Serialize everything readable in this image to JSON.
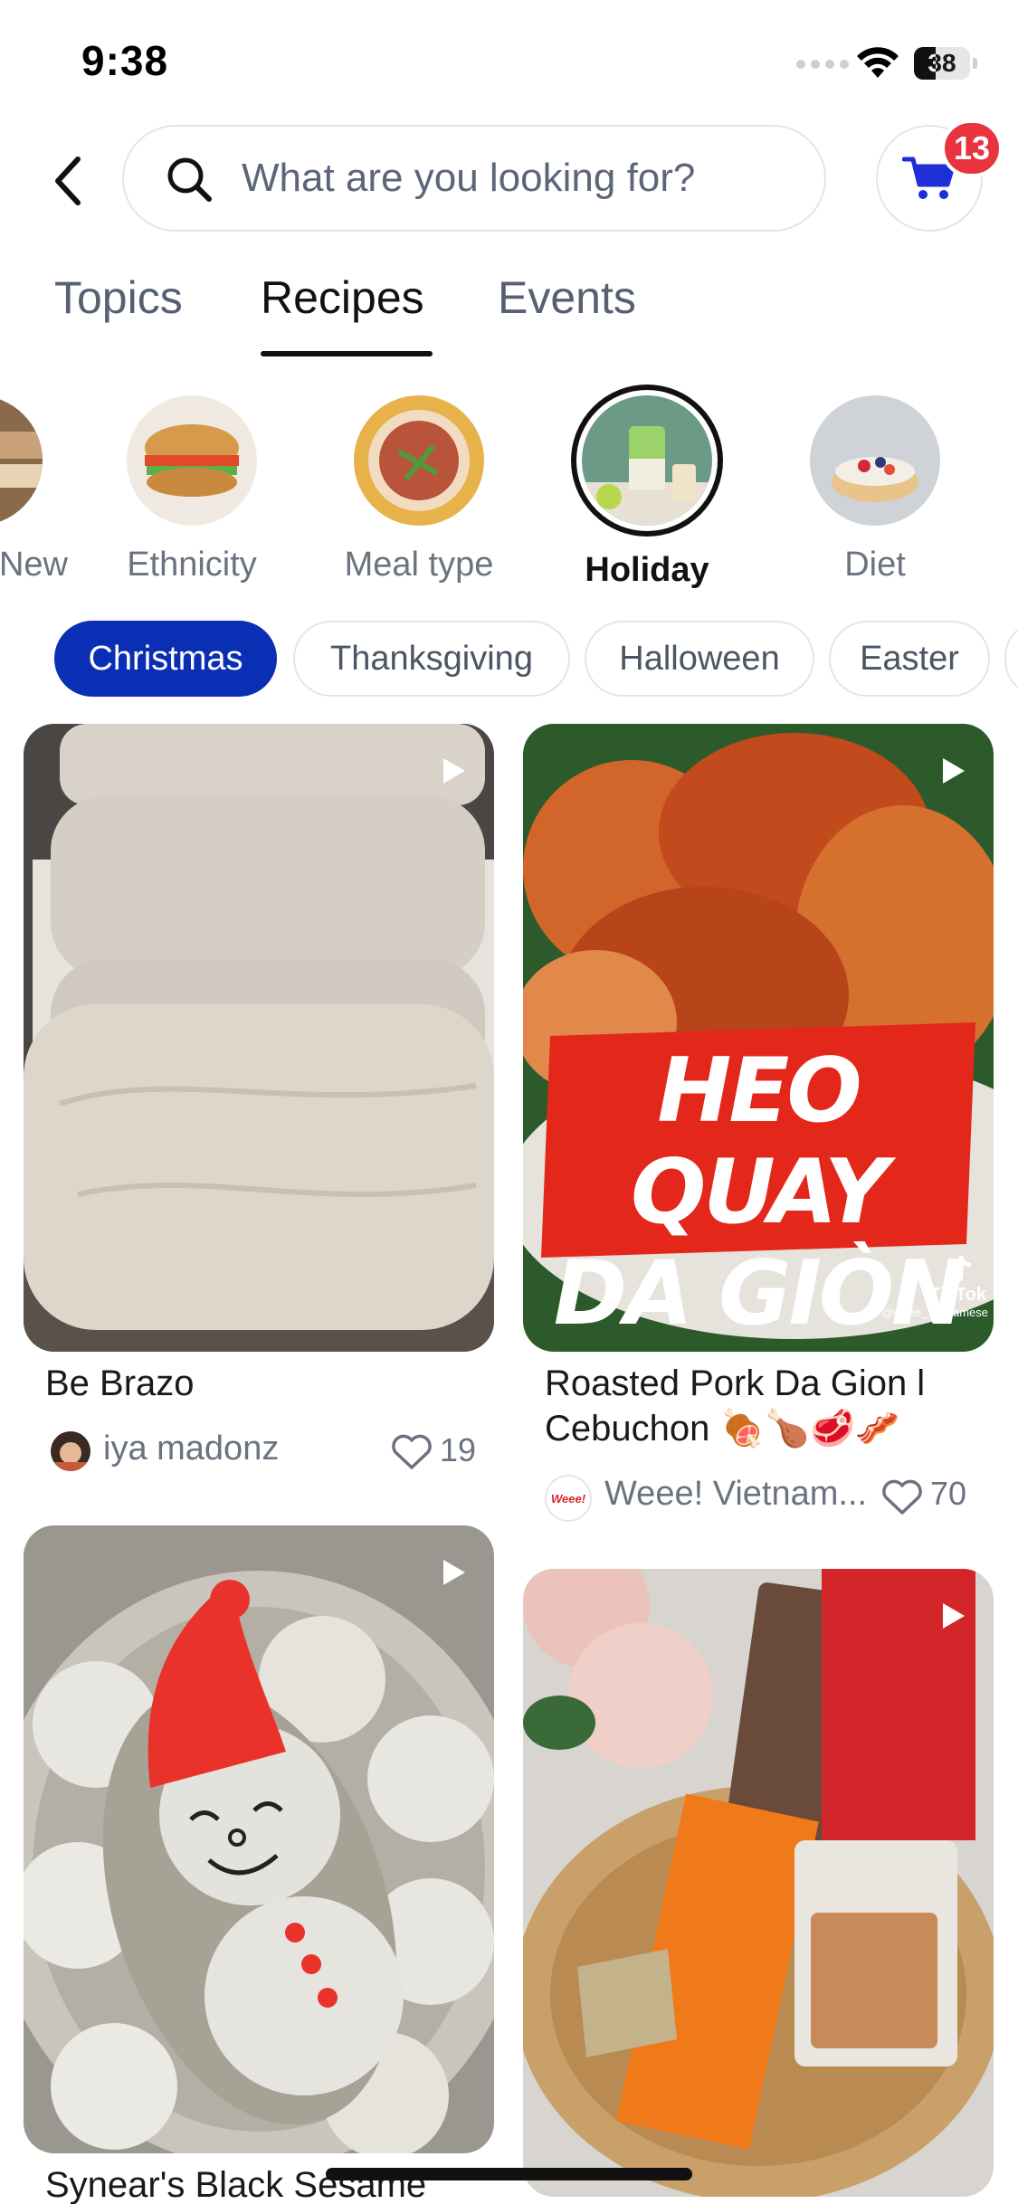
{
  "status_bar": {
    "time": "9:38",
    "battery": "38",
    "battery_level": 0.38
  },
  "search": {
    "placeholder": "What are you looking for?"
  },
  "cart": {
    "badge_count": "13"
  },
  "tabs": [
    {
      "label": "Topics"
    },
    {
      "label": "Recipes",
      "active": true
    },
    {
      "label": "Events"
    }
  ],
  "categories": [
    {
      "label": "New",
      "icon": "new-dish-image"
    },
    {
      "label": "Ethnicity",
      "icon": "sandwich-image"
    },
    {
      "label": "Meal type",
      "icon": "stew-bowl-image"
    },
    {
      "label": "Holiday",
      "icon": "green-drink-image",
      "active": true
    },
    {
      "label": "Diet",
      "icon": "fruit-tart-image"
    }
  ],
  "chips": [
    {
      "label": "Christmas",
      "active": true
    },
    {
      "label": "Thanksgiving"
    },
    {
      "label": "Halloween"
    },
    {
      "label": "Easter"
    }
  ],
  "recipes": [
    {
      "title": "Be Brazo",
      "author": "iya madonz",
      "likes": "19",
      "image": "flour-dusted-bread-rolls"
    },
    {
      "title": "Roasted Pork Da Gion l Cebuchon 🍖🍗🥩🥓",
      "author": "Weee! Vietnam...",
      "author_logo": "Weee!",
      "likes": "70",
      "image": "roasted-pork-video",
      "overlay_line1": "HEO QUAY",
      "overlay_line2": "DA GIÒN",
      "tiktok_label": "TikTok",
      "tiktok_handle": "@weee_vietnamese"
    },
    {
      "title": "Synear's Black Sesame",
      "image": "snowman-rice-balls"
    },
    {
      "title": "",
      "image": "gift-basket-dried-foods"
    }
  ],
  "colors": {
    "accent_blue": "#0b2fb4",
    "cart_blue": "#1e2fd8",
    "badge_red": "#e9343f",
    "muted_text": "#6b7280"
  }
}
